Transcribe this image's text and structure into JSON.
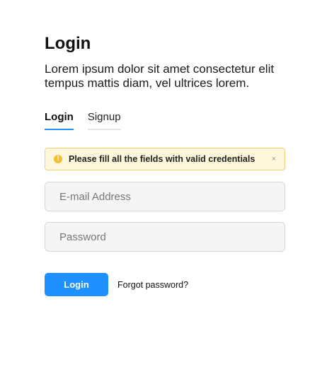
{
  "page": {
    "title": "Login",
    "subtitle": "Lorem ipsum dolor sit amet consectetur elit tempus mattis diam, vel ultrices lorem."
  },
  "tabs": [
    {
      "label": "Login",
      "active": true
    },
    {
      "label": "Signup",
      "active": false
    }
  ],
  "alert": {
    "icon": "warning-icon",
    "icon_glyph": "!",
    "message": "Please fill all the fields with valid credentials",
    "close_glyph": "×",
    "color": "#f0c030"
  },
  "form": {
    "email": {
      "placeholder": "E-mail Address",
      "value": ""
    },
    "password": {
      "placeholder": "Password",
      "value": ""
    }
  },
  "actions": {
    "submit_label": "Login",
    "forgot_label": "Forgot password?"
  },
  "colors": {
    "accent": "#1e90ff",
    "warning_bg": "#fff7dc",
    "warning_border": "#f0d27a"
  }
}
